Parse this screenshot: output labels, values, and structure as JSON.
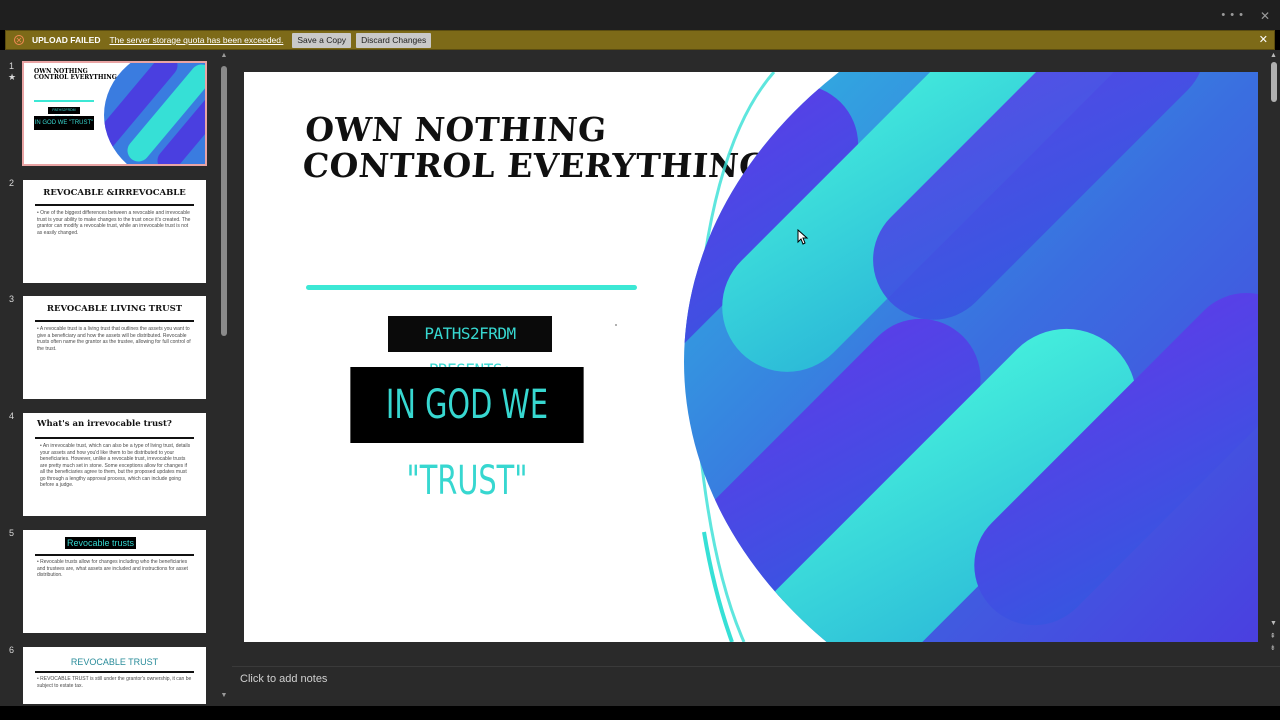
{
  "window": {
    "more_icon": "more-dots-icon",
    "close_icon": "close-icon"
  },
  "alert": {
    "title": "UPLOAD FAILED",
    "message": "The server storage quota has been exceeded.",
    "save_copy_label": "Save a Copy",
    "discard_label": "Discard Changes",
    "color": "#7d6a18"
  },
  "thumbnails": [
    {
      "num": "1",
      "star": "★",
      "title": "OWN NOTHING\nCONTROL EVERYTHING",
      "sub": "PATHS2FRDM PRESENTS",
      "box": "IN GOD WE \"TRUST\"",
      "selected": true
    },
    {
      "num": "2",
      "title": "REVOCABLE &IRREVOCABLE",
      "body": "• One of the biggest differences between a revocable and irrevocable trust is your ability to make changes to the trust once it's created. The grantor can modify a revocable trust, while an irrevocable trust is not as easily changed."
    },
    {
      "num": "3",
      "title": "REVOCABLE LIVING TRUST",
      "body": "• A revocable trust is a living trust that outlines the assets you want to give a beneficiary and how the assets will be distributed. Revocable trusts often name the grantor as the trustee, allowing for full control of the trust."
    },
    {
      "num": "4",
      "title": "What's an irrevocable trust?",
      "body": "• An irrevocable trust, which can also be a type of living trust, details your assets and how you'd like them to be distributed to your beneficiaries. However, unlike a revocable trust, irrevocable trusts are pretty much set in stone. Some exceptions allow for changes if all the beneficiaries agree to them, but the proposed updates must go through a lengthy approval process, which can include going before a judge."
    },
    {
      "num": "5",
      "title": "Revocable trusts",
      "body": "• Revocable trusts allow for changes including who the beneficiaries and trustees are, what assets are included and instructions for asset distribution."
    },
    {
      "num": "6",
      "title": "REVOCABLE TRUST",
      "body": "• REVOCABLE TRUST is still under the grantor's ownership, it can be subject to estate tax."
    }
  ],
  "slide": {
    "title": "OWN NOTHING\nCONTROL EVERYTHING",
    "presents": "PATHS2FRDM PRESENTS:",
    "trust_text": "IN GOD WE \"TRUST\"",
    "accent": "#3ce8d5",
    "art_colors": {
      "blue": "#4a3fe0",
      "teal": "#36e0d6",
      "mid": "#2f8fe0"
    }
  },
  "notes": {
    "placeholder": "Click to add notes"
  }
}
